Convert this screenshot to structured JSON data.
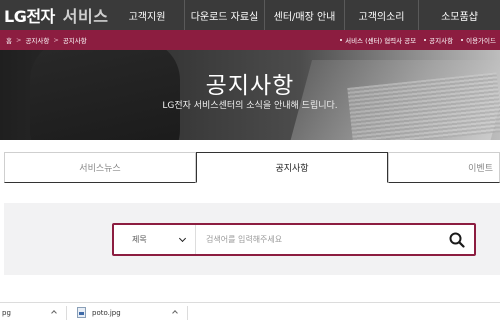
{
  "header": {
    "logo_brand": "LG전자",
    "logo_sub": "서비스",
    "menu": [
      "고객지원",
      "다운로드 자료실",
      "센터/매장 안내",
      "고객의소리",
      "소모품샵"
    ]
  },
  "breadcrumb": {
    "home_icon_label": "홈",
    "items": [
      "공지사항",
      "공지사항"
    ]
  },
  "quick_links": [
    "서비스 (센터) 협력사 공모",
    "공지사항",
    "이용가이드"
  ],
  "hero": {
    "title": "공지사항",
    "subtitle": "LG전자 서비스센터의 소식을 안내해 드립니다."
  },
  "tabs": [
    {
      "label": "서비스뉴스",
      "active": false
    },
    {
      "label": "공지사항",
      "active": true
    },
    {
      "label": "이벤트",
      "active": false
    }
  ],
  "search": {
    "select_value": "제목",
    "placeholder": "검색어를 입력해주세요"
  },
  "downloads": [
    {
      "name": "pg"
    },
    {
      "name": "poto.jpg"
    }
  ],
  "colors": {
    "brand": "#8c1d40",
    "topbar": "#3a3a3a"
  }
}
